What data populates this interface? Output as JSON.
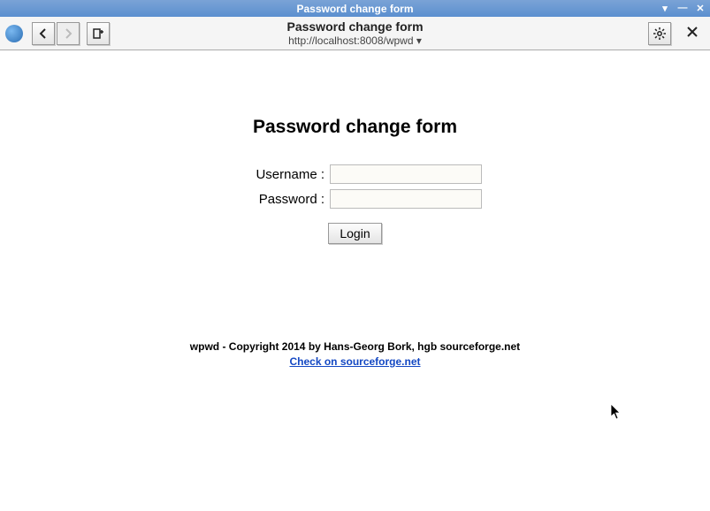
{
  "window": {
    "title": "Password change form"
  },
  "toolbar": {
    "page_title": "Password change form",
    "url": "http://localhost:8008/wpwd ▾",
    "back": "❮",
    "forward": "❯",
    "bookmark": "⟰",
    "settings": "✻",
    "close": "✕"
  },
  "page": {
    "heading": "Password change form",
    "username_label": "Username :",
    "password_label": "Password :",
    "username_value": "",
    "password_value": "",
    "login_label": "Login",
    "copyright": "wpwd - Copyright 2014 by Hans-Georg Bork, hgb sourceforge.net",
    "link_text": "Check on sourceforge.net"
  }
}
